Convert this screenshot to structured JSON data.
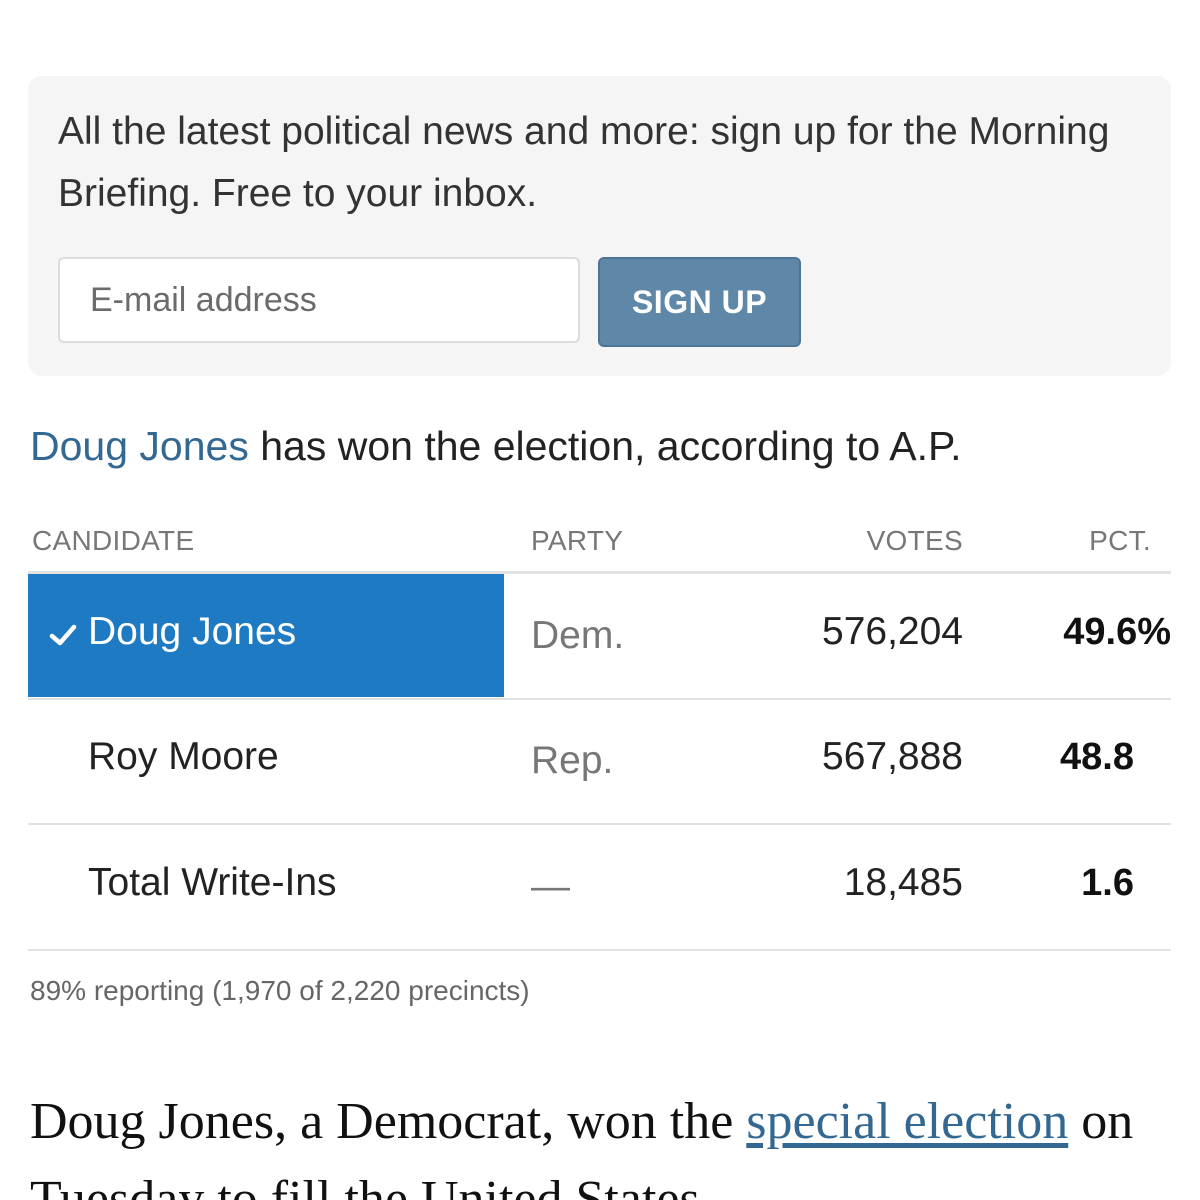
{
  "top_cut_text": "",
  "signup": {
    "text": "All the latest political news and more: sign up for the Morning Briefing. Free to your inbox.",
    "email_placeholder": "E-mail address",
    "button_label": "SIGN UP"
  },
  "headline": {
    "winner_name": "Doug Jones",
    "rest": " has won the election, according to A.P."
  },
  "table": {
    "headers": {
      "candidate": "CANDIDATE",
      "party": "PARTY",
      "votes": "VOTES",
      "pct": "PCT."
    },
    "rows": [
      {
        "candidate": "Doug Jones",
        "party": "Dem.",
        "votes": "576,204",
        "pct": "49.6%",
        "winner": true
      },
      {
        "candidate": "Roy Moore",
        "party": "Rep.",
        "votes": "567,888",
        "pct": "48.8",
        "winner": false
      },
      {
        "candidate": "Total Write-Ins",
        "party": "—",
        "votes": "18,485",
        "pct": "1.6",
        "winner": false
      }
    ],
    "reporting": "89% reporting (1,970 of 2,220 precincts)"
  },
  "article": {
    "before_link": "Doug Jones, a Democrat, won the ",
    "link_text": "special election",
    "after_link": " on Tuesday to fill the United States"
  },
  "colors": {
    "winner_highlight": "#1e7bc3",
    "link": "#326891",
    "button": "#5f87a8"
  },
  "icons": {
    "winner_check": "check-icon"
  }
}
